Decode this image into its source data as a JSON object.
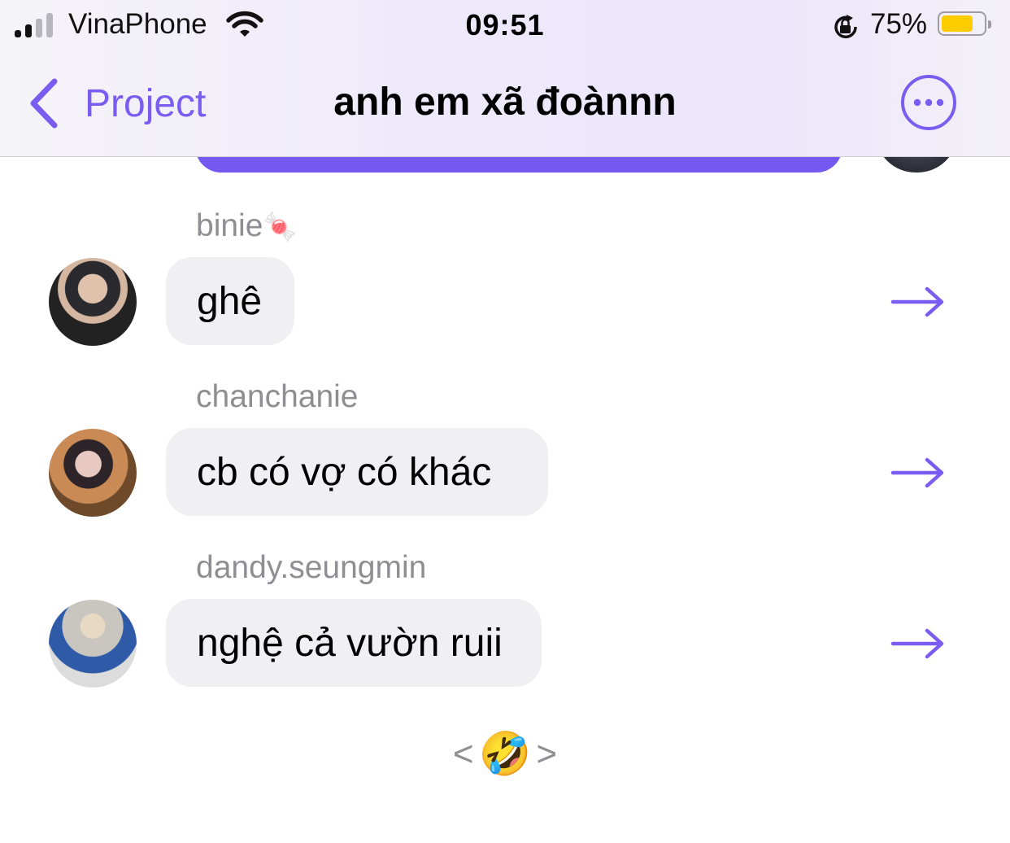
{
  "status_bar": {
    "carrier": "VinaPhone",
    "time": "09:51",
    "battery_percent": "75%",
    "battery_level": 0.75,
    "signal_bars_active": 2,
    "signal_bars_total": 4,
    "icons": [
      "signal-icon",
      "wifi-icon",
      "orientation-lock-icon",
      "battery-icon"
    ]
  },
  "nav": {
    "back_label": "Project",
    "title": "anh em xã đoànnn",
    "back_icon": "chevron-left-icon",
    "more_icon": "ellipsis-circle-icon"
  },
  "messages": [
    {
      "sender": "binie",
      "sender_emoji": "🍬",
      "text": "ghê",
      "avatar_icon": "avatar-photo-icon"
    },
    {
      "sender": "chanchanie",
      "text": "cb có vợ có khác",
      "avatar_icon": "avatar-photo-icon"
    },
    {
      "sender": "dandy.seungmin",
      "text": "nghệ cả vườn ruii",
      "avatar_icon": "avatar-photo-icon"
    }
  ],
  "reaction": {
    "open": "<",
    "emoji": "🤣",
    "close": ">"
  },
  "colors": {
    "accent": "#7b5cf0",
    "own_bubble": "#7558f0",
    "incoming_bubble": "#f0f0f2",
    "sender_name": "#8e8e93",
    "battery_fill": "#ffcc00"
  }
}
